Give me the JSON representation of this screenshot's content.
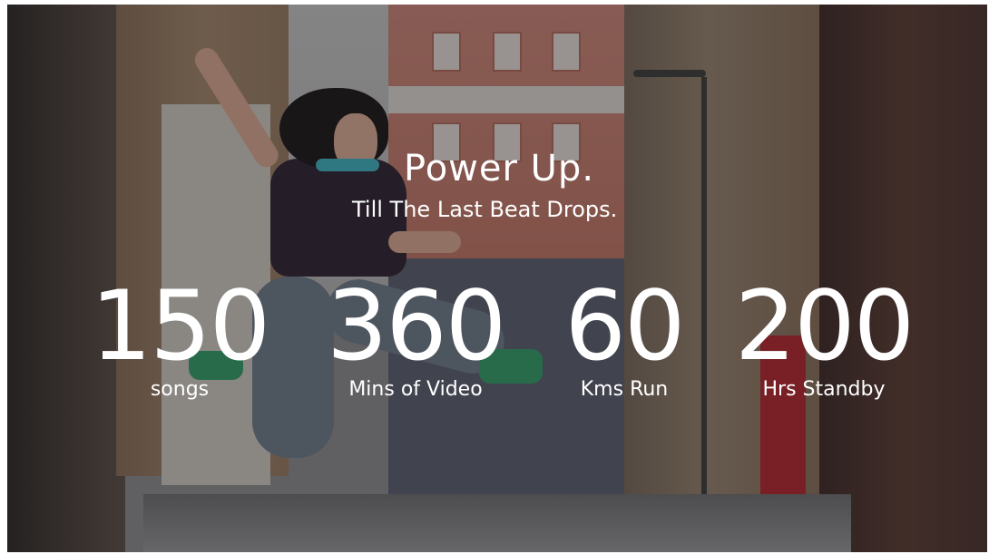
{
  "hero": {
    "headline": "Power Up.",
    "subline": "Till The Last Beat Drops."
  },
  "stats": [
    {
      "value": "150",
      "label": "songs"
    },
    {
      "value": "360",
      "label": "Mins of Video"
    },
    {
      "value": "60",
      "label": "Kms Run"
    },
    {
      "value": "200",
      "label": "Hrs Standby"
    }
  ],
  "colors": {
    "text": "#ffffff",
    "overlay": "#1e1c1e"
  }
}
